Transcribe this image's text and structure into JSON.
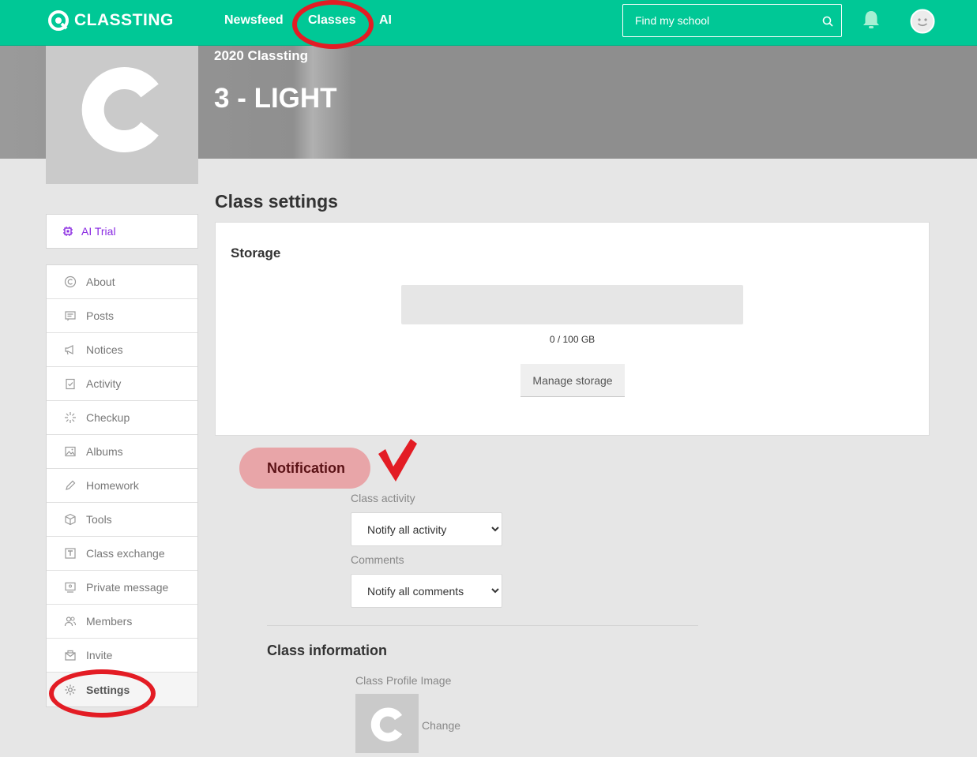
{
  "brand": {
    "name": "CLASSTING"
  },
  "nav": {
    "newsfeed": "Newsfeed",
    "classes": "Classes",
    "ai": "AI"
  },
  "search": {
    "placeholder": "Find my school"
  },
  "class_header": {
    "school": "2020 Classting",
    "name": "3 - LIGHT"
  },
  "page": {
    "title": "Class settings"
  },
  "sidebar": {
    "ai_trial": "AI Trial",
    "items": [
      {
        "label": "About",
        "icon": "copyright-icon"
      },
      {
        "label": "Posts",
        "icon": "posts-icon"
      },
      {
        "label": "Notices",
        "icon": "megaphone-icon"
      },
      {
        "label": "Activity",
        "icon": "clipboard-check-icon"
      },
      {
        "label": "Checkup",
        "icon": "sparkle-icon"
      },
      {
        "label": "Albums",
        "icon": "image-icon"
      },
      {
        "label": "Homework",
        "icon": "pencil-icon"
      },
      {
        "label": "Tools",
        "icon": "cube-icon"
      },
      {
        "label": "Class exchange",
        "icon": "exchange-icon"
      },
      {
        "label": "Private message",
        "icon": "message-icon"
      },
      {
        "label": "Members",
        "icon": "members-icon"
      },
      {
        "label": "Invite",
        "icon": "invite-icon"
      },
      {
        "label": "Settings",
        "icon": "gear-icon"
      }
    ]
  },
  "storage": {
    "title": "Storage",
    "usage": "0 / 100 GB",
    "used_fraction": 0,
    "manage_label": "Manage storage"
  },
  "notification": {
    "title": "Notification",
    "class_activity_label": "Class activity",
    "class_activity_value": "Notify all activity",
    "comments_label": "Comments",
    "comments_value": "Notify all comments"
  },
  "class_information": {
    "title": "Class information",
    "profile_image_label": "Class Profile Image",
    "change_label": "Change"
  },
  "colors": {
    "brand": "#00c896",
    "annotation": "#e31c24",
    "ai_trial": "#8a2be2"
  }
}
